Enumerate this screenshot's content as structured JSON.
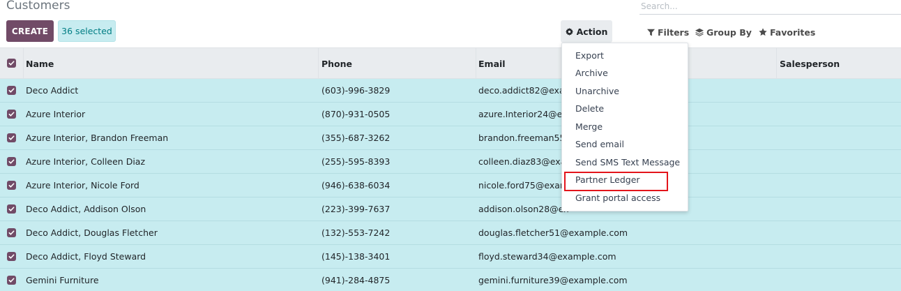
{
  "page": {
    "title": "Customers"
  },
  "search": {
    "placeholder": "Search..."
  },
  "toolbar": {
    "create_label": "CREATE",
    "selected_label": "36 selected",
    "action_label": "Action",
    "filters_label": "Filters",
    "group_by_label": "Group By",
    "favorites_label": "Favorites"
  },
  "action_menu": {
    "items": [
      "Export",
      "Archive",
      "Unarchive",
      "Delete",
      "Merge",
      "Send email",
      "Send SMS Text Message",
      "Partner Ledger",
      "Grant portal access"
    ],
    "highlighted_item": "Partner Ledger"
  },
  "table": {
    "columns": [
      "Name",
      "Phone",
      "Email",
      "Salesperson"
    ],
    "rows": [
      {
        "name": "Deco Addict",
        "phone": "(603)-996-3829",
        "email": "deco.addict82@exam"
      },
      {
        "name": "Azure Interior",
        "phone": "(870)-931-0505",
        "email": "azure.Interior24@ex"
      },
      {
        "name": "Azure Interior, Brandon Freeman",
        "phone": "(355)-687-3262",
        "email": "brandon.freeman55"
      },
      {
        "name": "Azure Interior, Colleen Diaz",
        "phone": "(255)-595-8393",
        "email": "colleen.diaz83@exa"
      },
      {
        "name": "Azure Interior, Nicole Ford",
        "phone": "(946)-638-6034",
        "email": "nicole.ford75@exam"
      },
      {
        "name": "Deco Addict, Addison Olson",
        "phone": "(223)-399-7637",
        "email": "addison.olson28@ex"
      },
      {
        "name": "Deco Addict, Douglas Fletcher",
        "phone": "(132)-553-7242",
        "email": "douglas.fletcher51@example.com"
      },
      {
        "name": "Deco Addict, Floyd Steward",
        "phone": "(145)-138-3401",
        "email": "floyd.steward34@example.com"
      },
      {
        "name": "Gemini Furniture",
        "phone": "(941)-284-4875",
        "email": "gemini.furniture39@example.com"
      }
    ]
  },
  "colors": {
    "primary": "#714b67",
    "selected_row": "#c7ecf0",
    "badge_text": "#017e84",
    "highlight_border": "#e3141b"
  },
  "icons": {
    "action": "gear-icon",
    "filters": "filter-icon",
    "group_by": "layers-icon",
    "favorites": "star-icon",
    "checkbox": "checkbox-checked-icon"
  }
}
